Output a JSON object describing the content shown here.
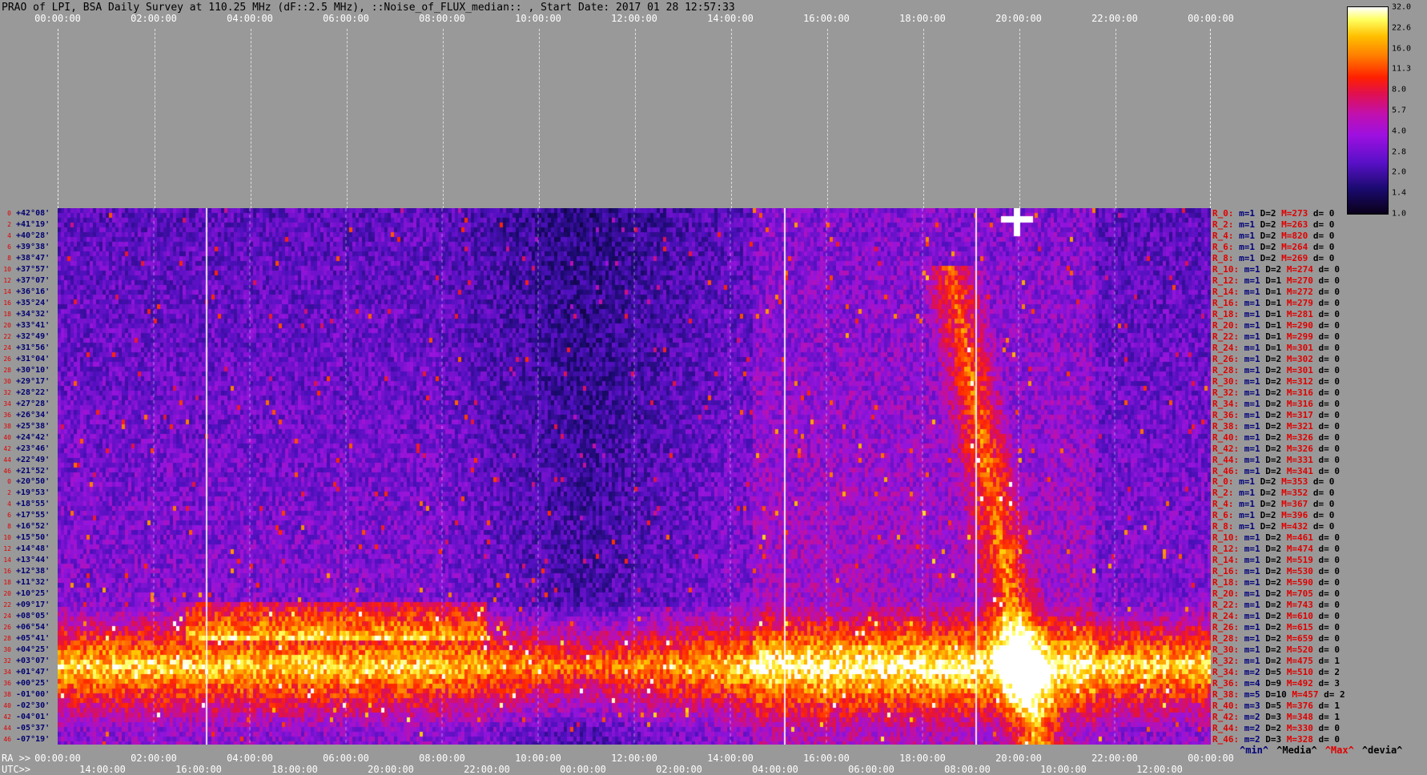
{
  "title": "PRAO of LPI, BSA Daily Survey at 110.25 MHz (dF::2.5 MHz), ::Noise_of_FLUX_median:: , Start Date: 2017 01 28 12:57:33",
  "top_axis_ticks": [
    "00:00:00",
    "02:00:00",
    "04:00:00",
    "06:00:00",
    "08:00:00",
    "10:00:00",
    "12:00:00",
    "14:00:00",
    "16:00:00",
    "18:00:00",
    "20:00:00",
    "22:00:00",
    "00:00:00"
  ],
  "bottom_ra_prefix": "RA >>",
  "bottom_ra_ticks": [
    "00:00:00",
    "02:00:00",
    "04:00:00",
    "06:00:00",
    "08:00:00",
    "10:00:00",
    "12:00:00",
    "14:00:00",
    "16:00:00",
    "18:00:00",
    "20:00:00",
    "22:00:00",
    "00:00:00"
  ],
  "bottom_utc_prefix": "UTC>>",
  "bottom_utc_ticks": [
    "14:00:00",
    "16:00:00",
    "18:00:00",
    "20:00:00",
    "22:00:00",
    "00:00:00",
    "02:00:00",
    "04:00:00",
    "06:00:00",
    "08:00:00",
    "10:00:00",
    "12:00:00"
  ],
  "legend_keys": [
    {
      "label": "^min^",
      "color": "#00007a"
    },
    {
      "label": "^Media^",
      "color": "#000000"
    },
    {
      "label": "^Max^",
      "color": "#e00000"
    },
    {
      "label": "^devia^",
      "color": "#000000"
    }
  ],
  "colorbar_ticks": [
    "32.0",
    "22.6",
    "16.0",
    "11.3",
    "8.0",
    "5.7",
    "4.0",
    "2.8",
    "2.0",
    "1.4",
    "1.0"
  ],
  "declinations": [
    "+42°08'",
    "+41°19'",
    "+40°28'",
    "+39°38'",
    "+38°47'",
    "+37°57'",
    "+37°07'",
    "+36°16'",
    "+35°24'",
    "+34°32'",
    "+33°41'",
    "+32°49'",
    "+31°56'",
    "+31°04'",
    "+30°10'",
    "+29°17'",
    "+28°22'",
    "+27°28'",
    "+26°34'",
    "+25°38'",
    "+24°42'",
    "+23°46'",
    "+22°49'",
    "+21°52'",
    "+20°50'",
    "+19°53'",
    "+18°55'",
    "+17°55'",
    "+16°52'",
    "+15°50'",
    "+14°48'",
    "+13°44'",
    "+12°38'",
    "+11°32'",
    "+10°25'",
    "+09°17'",
    "+08°05'",
    "+06°54'",
    "+05°41'",
    "+04°25'",
    "+03°07'",
    "+01°47'",
    "+00°25'",
    "-01°00'",
    "-02°30'",
    "-04°01'",
    "-05°37'",
    "-07°19'"
  ],
  "row_numbers": [
    "0",
    "2",
    "4",
    "6",
    "8",
    "10",
    "12",
    "14",
    "16",
    "18",
    "20",
    "22",
    "24",
    "26",
    "28",
    "30",
    "32",
    "34",
    "36",
    "38",
    "40",
    "42",
    "44",
    "46",
    "0",
    "2",
    "4",
    "6",
    "8",
    "10",
    "12",
    "14",
    "16",
    "18",
    "20",
    "22",
    "24",
    "26",
    "28",
    "30",
    "32",
    "34",
    "36",
    "38",
    "40",
    "42",
    "44",
    "46"
  ],
  "stats": [
    {
      "r": "R_0:",
      "m": "m=1",
      "d": "D=2",
      "mx": "M=273",
      "dv": "d= 0"
    },
    {
      "r": "R_2:",
      "m": "m=1",
      "d": "D=2",
      "mx": "M=263",
      "dv": "d= 0"
    },
    {
      "r": "R_4:",
      "m": "m=1",
      "d": "D=2",
      "mx": "M=820",
      "dv": "d= 0"
    },
    {
      "r": "R_6:",
      "m": "m=1",
      "d": "D=2",
      "mx": "M=264",
      "dv": "d= 0"
    },
    {
      "r": "R_8:",
      "m": "m=1",
      "d": "D=2",
      "mx": "M=269",
      "dv": "d= 0"
    },
    {
      "r": "R_10:",
      "m": "m=1",
      "d": "D=2",
      "mx": "M=274",
      "dv": "d= 0"
    },
    {
      "r": "R_12:",
      "m": "m=1",
      "d": "D=1",
      "mx": "M=270",
      "dv": "d= 0"
    },
    {
      "r": "R_14:",
      "m": "m=1",
      "d": "D=1",
      "mx": "M=272",
      "dv": "d= 0"
    },
    {
      "r": "R_16:",
      "m": "m=1",
      "d": "D=1",
      "mx": "M=279",
      "dv": "d= 0"
    },
    {
      "r": "R_18:",
      "m": "m=1",
      "d": "D=1",
      "mx": "M=281",
      "dv": "d= 0"
    },
    {
      "r": "R_20:",
      "m": "m=1",
      "d": "D=1",
      "mx": "M=290",
      "dv": "d= 0"
    },
    {
      "r": "R_22:",
      "m": "m=1",
      "d": "D=1",
      "mx": "M=299",
      "dv": "d= 0"
    },
    {
      "r": "R_24:",
      "m": "m=1",
      "d": "D=1",
      "mx": "M=301",
      "dv": "d= 0"
    },
    {
      "r": "R_26:",
      "m": "m=1",
      "d": "D=2",
      "mx": "M=302",
      "dv": "d= 0"
    },
    {
      "r": "R_28:",
      "m": "m=1",
      "d": "D=2",
      "mx": "M=301",
      "dv": "d= 0"
    },
    {
      "r": "R_30:",
      "m": "m=1",
      "d": "D=2",
      "mx": "M=312",
      "dv": "d= 0"
    },
    {
      "r": "R_32:",
      "m": "m=1",
      "d": "D=2",
      "mx": "M=316",
      "dv": "d= 0"
    },
    {
      "r": "R_34:",
      "m": "m=1",
      "d": "D=2",
      "mx": "M=316",
      "dv": "d= 0"
    },
    {
      "r": "R_36:",
      "m": "m=1",
      "d": "D=2",
      "mx": "M=317",
      "dv": "d= 0"
    },
    {
      "r": "R_38:",
      "m": "m=1",
      "d": "D=2",
      "mx": "M=321",
      "dv": "d= 0"
    },
    {
      "r": "R_40:",
      "m": "m=1",
      "d": "D=2",
      "mx": "M=326",
      "dv": "d= 0"
    },
    {
      "r": "R_42:",
      "m": "m=1",
      "d": "D=2",
      "mx": "M=326",
      "dv": "d= 0"
    },
    {
      "r": "R_44:",
      "m": "m=1",
      "d": "D=2",
      "mx": "M=331",
      "dv": "d= 0"
    },
    {
      "r": "R_46:",
      "m": "m=1",
      "d": "D=2",
      "mx": "M=341",
      "dv": "d= 0"
    },
    {
      "r": "R_0:",
      "m": "m=1",
      "d": "D=2",
      "mx": "M=353",
      "dv": "d= 0"
    },
    {
      "r": "R_2:",
      "m": "m=1",
      "d": "D=2",
      "mx": "M=352",
      "dv": "d= 0"
    },
    {
      "r": "R_4:",
      "m": "m=1",
      "d": "D=2",
      "mx": "M=367",
      "dv": "d= 0"
    },
    {
      "r": "R_6:",
      "m": "m=1",
      "d": "D=2",
      "mx": "M=396",
      "dv": "d= 0"
    },
    {
      "r": "R_8:",
      "m": "m=1",
      "d": "D=2",
      "mx": "M=432",
      "dv": "d= 0"
    },
    {
      "r": "R_10:",
      "m": "m=1",
      "d": "D=2",
      "mx": "M=461",
      "dv": "d= 0"
    },
    {
      "r": "R_12:",
      "m": "m=1",
      "d": "D=2",
      "mx": "M=474",
      "dv": "d= 0"
    },
    {
      "r": "R_14:",
      "m": "m=1",
      "d": "D=2",
      "mx": "M=519",
      "dv": "d= 0"
    },
    {
      "r": "R_16:",
      "m": "m=1",
      "d": "D=2",
      "mx": "M=530",
      "dv": "d= 0"
    },
    {
      "r": "R_18:",
      "m": "m=1",
      "d": "D=2",
      "mx": "M=590",
      "dv": "d= 0"
    },
    {
      "r": "R_20:",
      "m": "m=1",
      "d": "D=2",
      "mx": "M=705",
      "dv": "d= 0"
    },
    {
      "r": "R_22:",
      "m": "m=1",
      "d": "D=2",
      "mx": "M=743",
      "dv": "d= 0"
    },
    {
      "r": "R_24:",
      "m": "m=1",
      "d": "D=2",
      "mx": "M=610",
      "dv": "d= 0"
    },
    {
      "r": "R_26:",
      "m": "m=1",
      "d": "D=2",
      "mx": "M=615",
      "dv": "d= 0"
    },
    {
      "r": "R_28:",
      "m": "m=1",
      "d": "D=2",
      "mx": "M=659",
      "dv": "d= 0"
    },
    {
      "r": "R_30:",
      "m": "m=1",
      "d": "D=2",
      "mx": "M=520",
      "dv": "d= 0"
    },
    {
      "r": "R_32:",
      "m": "m=1",
      "d": "D=2",
      "mx": "M=475",
      "dv": "d= 1"
    },
    {
      "r": "R_34:",
      "m": "m=2",
      "d": "D=5",
      "mx": "M=510",
      "dv": "d= 2"
    },
    {
      "r": "R_36:",
      "m": "m=4",
      "d": "D=9",
      "mx": "M=492",
      "dv": "d= 3"
    },
    {
      "r": "R_38:",
      "m": "m=5",
      "d": "D=10",
      "mx": "M=457",
      "dv": "d= 2"
    },
    {
      "r": "R_40:",
      "m": "m=3",
      "d": "D=5",
      "mx": "M=376",
      "dv": "d= 1"
    },
    {
      "r": "R_42:",
      "m": "m=2",
      "d": "D=3",
      "mx": "M=348",
      "dv": "d= 1"
    },
    {
      "r": "R_44:",
      "m": "m=2",
      "d": "D=2",
      "mx": "M=330",
      "dv": "d= 0"
    },
    {
      "r": "R_46:",
      "m": "m=2",
      "d": "D=3",
      "mx": "M=328",
      "dv": "d= 0"
    }
  ]
}
